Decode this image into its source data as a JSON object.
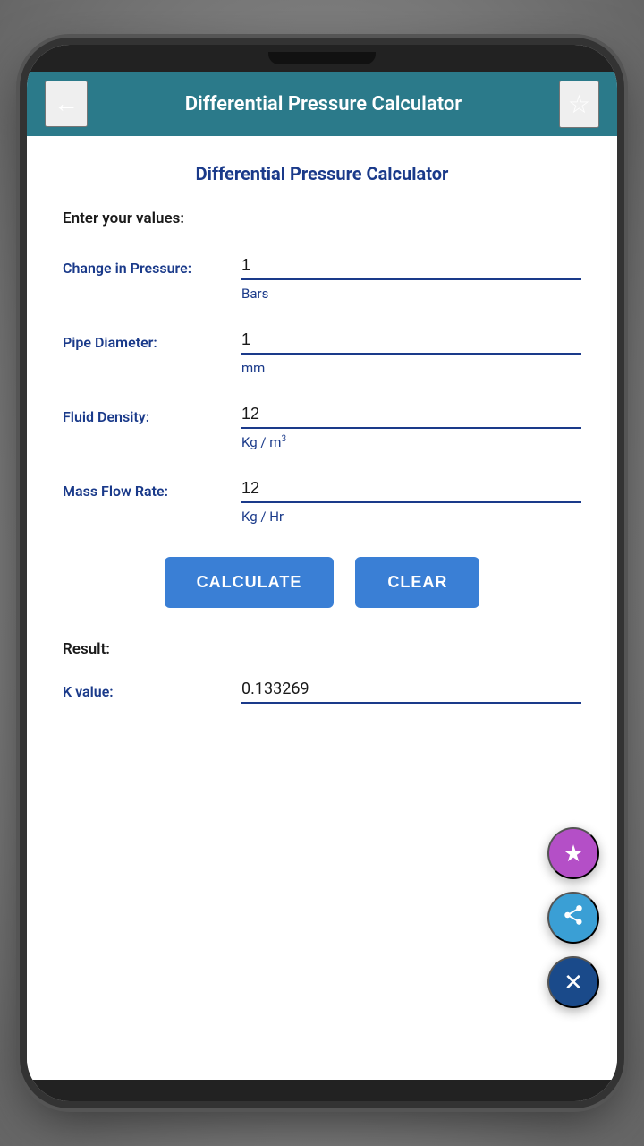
{
  "app": {
    "header": {
      "title": "Differential Pressure Calculator",
      "back_icon": "←",
      "star_icon": "☆"
    }
  },
  "content": {
    "section_title": "Differential Pressure Calculator",
    "form_intro": "Enter your values:",
    "fields": [
      {
        "label": "Change in Pressure:",
        "value": "1",
        "unit": "Bars",
        "id": "change_in_pressure"
      },
      {
        "label": "Pipe Diameter:",
        "value": "1",
        "unit": "mm",
        "id": "pipe_diameter"
      },
      {
        "label": "Fluid Density:",
        "value": "12",
        "unit": "Kg / m³",
        "unit_has_sup": true,
        "id": "fluid_density"
      },
      {
        "label": "Mass Flow Rate:",
        "value": "12",
        "unit": "Kg / Hr",
        "id": "mass_flow_rate"
      }
    ],
    "buttons": {
      "calculate": "CALCULATE",
      "clear": "CLEAR"
    },
    "result": {
      "label": "Result:",
      "k_value_label": "K value:",
      "k_value": "0.133269"
    }
  },
  "fabs": {
    "star_icon": "★",
    "share_icon": "⤴",
    "close_icon": "✕"
  }
}
